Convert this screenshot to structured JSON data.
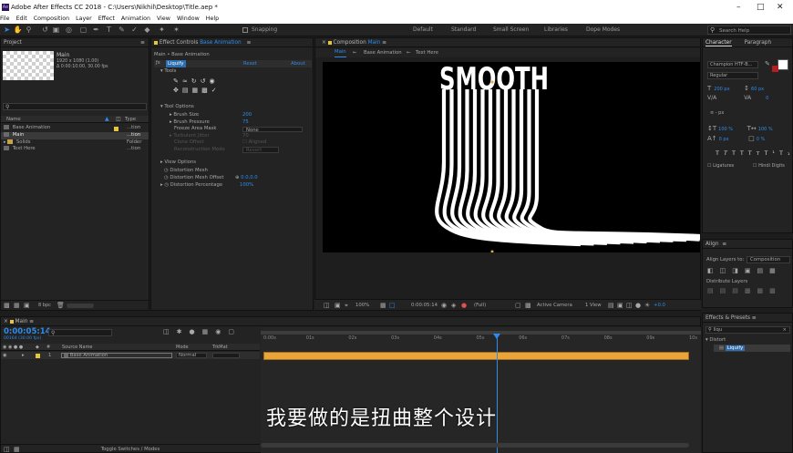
{
  "app": {
    "title": "Adobe After Effects CC 2018 - C:\\Users\\Nikhil\\Desktop\\Title.aep *",
    "logo": "Ae"
  },
  "menu": [
    "File",
    "Edit",
    "Composition",
    "Layer",
    "Effect",
    "Animation",
    "View",
    "Window",
    "Help"
  ],
  "toolbar": {
    "snapping": "Snapping",
    "workspaces": [
      "Default",
      "Standard",
      "Small Screen",
      "Libraries",
      "Dope Modes"
    ],
    "search_placeholder": "Search Help"
  },
  "project": {
    "title": "Project",
    "item_name": "Main",
    "item_info1": "1920 x 1080 (1.00)",
    "item_info2": "Δ 0:00:10:00, 30.00 fps",
    "columns": {
      "name": "Name",
      "type": "Type"
    },
    "items": [
      {
        "name": "Base Animation",
        "type": "...tion",
        "color": "#e7c53c",
        "icon": "comp-icon"
      },
      {
        "name": "Main",
        "type": "...tion",
        "color": "#e7c53c",
        "icon": "comp-icon"
      },
      {
        "name": "Solids",
        "type": "Folder",
        "color": "#e7c53c",
        "icon": "folder-icon"
      },
      {
        "name": "Text Here",
        "type": "...tion",
        "color": "#e7c53c",
        "icon": "comp-icon"
      }
    ],
    "bpc": "8 bpc"
  },
  "effects": {
    "title": "Effect Controls",
    "layer": "Base Animation",
    "breadcrumb": "Main • Base Animation",
    "fx_name": "Liquify",
    "reset": "Reset",
    "about": "About",
    "tools": "Tools",
    "tool_options": "Tool Options",
    "props": [
      {
        "label": "Brush Size",
        "value": "200"
      },
      {
        "label": "Brush Pressure",
        "value": "75"
      },
      {
        "label": "Freeze Area Mask",
        "value": "None"
      },
      {
        "label": "Turbulent Jitter",
        "value": "70"
      },
      {
        "label": "Clone Offset",
        "value": "Aligned"
      },
      {
        "label": "Reconstruction Mode",
        "value": "Revert"
      }
    ],
    "view_options": "View Options",
    "distortion_mesh": "Distortion Mesh",
    "mesh_offset": "Distortion Mesh Offset",
    "mesh_offset_val": "0.0,0.0",
    "dist_pct": "Distortion Percentage",
    "dist_pct_val": "100%"
  },
  "composition": {
    "title": "Composition",
    "name": "Main",
    "tabs": [
      "Main",
      "Base Animation",
      "Text Here"
    ],
    "artwork_text": "SMOOTH",
    "footer": {
      "zoom": "100%",
      "time": "0:00:05:14",
      "res": "(Full)",
      "camera": "Active Camera",
      "view": "1 View",
      "exposure": "+0.0"
    }
  },
  "character": {
    "tab1": "Character",
    "tab2": "Paragraph",
    "font": "Champion HTF-B...",
    "style": "Regular",
    "size": "200 px",
    "leading": "60 px",
    "tracking": "0",
    "unit": "- px",
    "scale_v": "100 %",
    "scale_h": "100 %",
    "baseline": "0 px",
    "tsume": "0 %",
    "ligatures": "Ligatures",
    "hindi_digits": "Hindi Digits"
  },
  "align": {
    "title": "Align",
    "align_to": "Align Layers to:",
    "target": "Composition",
    "distribute": "Distribute Layers"
  },
  "fxpresets": {
    "title": "Effects & Presets",
    "search": "liqu",
    "category": "Distort",
    "item": "Liquify"
  },
  "timeline": {
    "tab": "Main",
    "timecode": "0:00:05:14",
    "fps": "00164 (30.00 fps)",
    "search_placeholder": "",
    "columns": {
      "source": "Source Name",
      "mode": "Mode",
      "trkmat": "TrkMat"
    },
    "layers": [
      {
        "num": "1",
        "name": "Base Animation",
        "mode": "Normal"
      }
    ],
    "ruler": [
      "0:00s",
      "01s",
      "02s",
      "03s",
      "04s",
      "05s",
      "06s",
      "07s",
      "08s",
      "09s",
      "10s"
    ],
    "toggle": "Toggle Switches / Modes"
  },
  "subtitle": "我要做的是扭曲整个设计",
  "colors": {
    "accent": "#2d8ceb",
    "layer_bar": "#e9a53a",
    "label_yellow": "#e7c53c"
  }
}
